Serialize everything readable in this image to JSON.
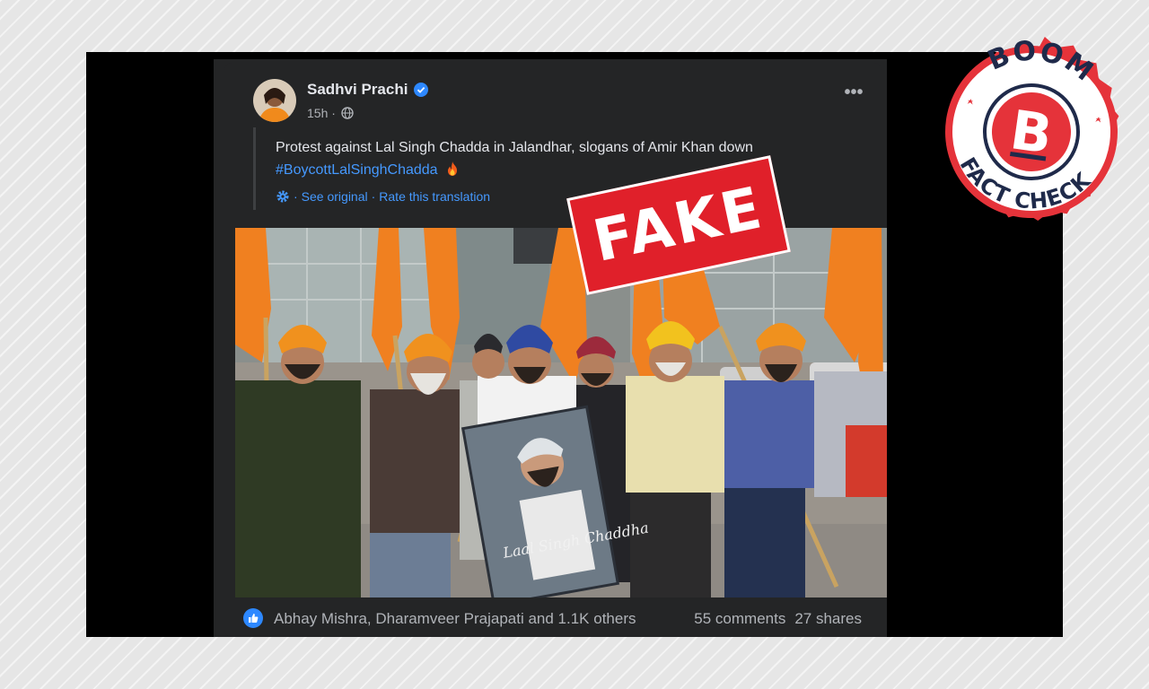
{
  "post": {
    "author": "Sadhvi Prachi",
    "time": "15h",
    "text": "Protest against Lal Singh Chadda in Jalandhar, slogans of Amir Khan down",
    "hashtag": "#BoycottLalSinghChadda",
    "see_original": "See original",
    "rate_translation": "Rate this translation",
    "separator": "·"
  },
  "icons": {
    "verified": "verified-badge-icon",
    "privacy": "globe-icon",
    "more": "more-options-icon",
    "translate": "gear-icon",
    "like": "like-icon",
    "emoji": "fire-emoji-icon"
  },
  "photo": {
    "poster_text": "Laal Singh Chaddha"
  },
  "reactions": {
    "names": "Abhay Mishra, Dharamveer Prajapati and 1.1K others",
    "comments": "55 comments",
    "shares": "27 shares"
  },
  "overlay": {
    "stamp": "FAKE",
    "logo_top": "BOOM",
    "logo_letter": "B",
    "logo_bottom": "FACT CHECK"
  },
  "colors": {
    "card_bg": "#242526",
    "link": "#4599ff",
    "stamp_red": "#e0202a",
    "verified_blue": "#2d88ff"
  }
}
